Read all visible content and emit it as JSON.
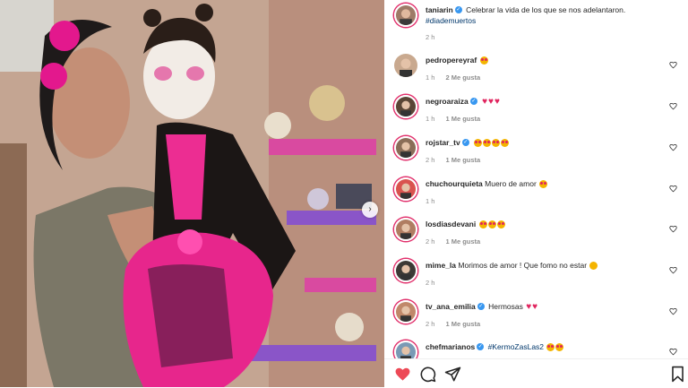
{
  "post": {
    "author": "taniarin",
    "caption": "Celebrar la vida de los que se nos adelantaron.",
    "hashtag": "#diademuertos",
    "time": "2 h"
  },
  "comments": [
    {
      "user": "pedropereyraf",
      "verified": false,
      "text": "",
      "emojis": [
        "face-love"
      ],
      "time": "1 h",
      "likes": "2 Me gusta"
    },
    {
      "user": "negroaraiza",
      "verified": true,
      "text": "",
      "emojis": [
        "heart",
        "heart",
        "heart"
      ],
      "time": "1 h",
      "likes": "1 Me gusta"
    },
    {
      "user": "rojstar_tv",
      "verified": true,
      "text": "",
      "emojis": [
        "face-love",
        "face-love",
        "face-love",
        "face-love"
      ],
      "time": "2 h",
      "likes": "1 Me gusta"
    },
    {
      "user": "chuchourquieta",
      "verified": false,
      "text": "Muero de amor",
      "emojis": [
        "face-love"
      ],
      "time": "1 h",
      "likes": ""
    },
    {
      "user": "losdiasdevani",
      "verified": false,
      "text": "",
      "emojis": [
        "face-love",
        "face-love",
        "face-love"
      ],
      "time": "2 h",
      "likes": "1 Me gusta"
    },
    {
      "user": "mime_la",
      "verified": false,
      "text": "Morimos de amor ! Que fomo no estar",
      "emojis": [
        "face-sad"
      ],
      "time": "2 h",
      "likes": ""
    },
    {
      "user": "tv_ana_emilia",
      "verified": true,
      "text": "Hermosas",
      "emojis": [
        "heart",
        "heart"
      ],
      "time": "2 h",
      "likes": "1 Me gusta"
    },
    {
      "user": "chefmarianos",
      "verified": true,
      "text": "#KermoZasLas2",
      "emojis": [
        "face-love",
        "face-love"
      ],
      "time": "",
      "likes": ""
    }
  ],
  "icons": {
    "like": "heart-filled-icon",
    "comment": "comment-icon",
    "share": "share-icon",
    "save": "bookmark-icon",
    "next": "chevron-right-icon"
  },
  "colors": {
    "accent_pink": "#e1306c",
    "liked_red": "#ed4956",
    "verified_blue": "#3897f0",
    "hashtag_blue": "#00376b"
  }
}
